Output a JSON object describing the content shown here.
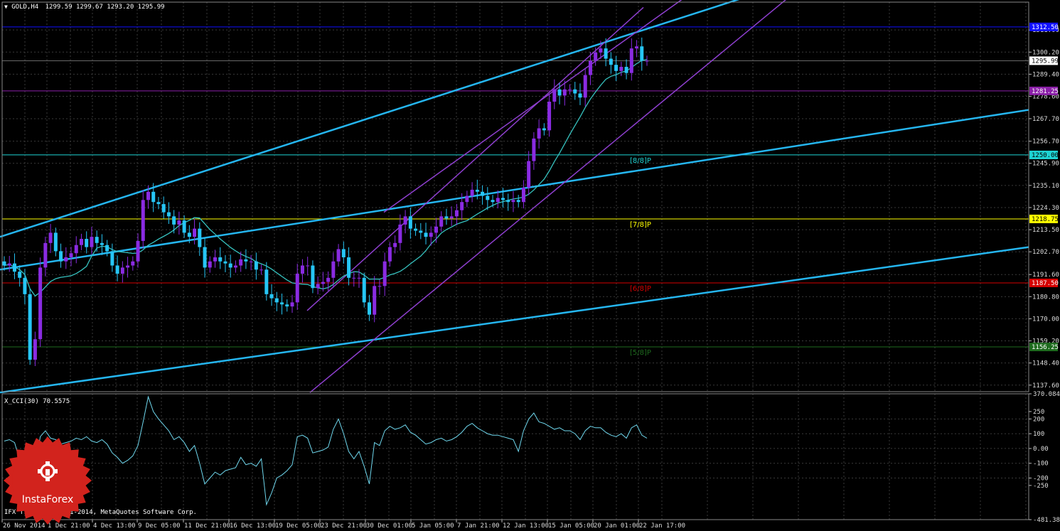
{
  "title": "GOLD,H4",
  "ohlc": {
    "values": "1299.59 1299.67 1293.20 1295.99"
  },
  "copyright": "IFX Trader, © 2001-2014, MetaQuotes Software Corp.",
  "logo_text": "InstaForex",
  "colors": {
    "background": "#000000",
    "grid": "#3a3a3a",
    "bull_candle": "#8a2be2",
    "bear_candle": "#26c6f6",
    "channel": "#8e3fcf",
    "trendline": "#25b6f0",
    "ma": "#36c2bf",
    "cci": "#6fd8ee",
    "level_8_8": "#1ed3d3",
    "level_7_8": "#ffff00",
    "level_6_8": "#d50000",
    "level_5_8": "#1e6b1e",
    "level_top": "#1111ff",
    "level_purple": "#8b1fa8"
  },
  "chart_data": [
    {
      "type": "candlestick",
      "title": "GOLD,H4",
      "price_ticks": [
        "1311.00",
        "1300.20",
        "1289.40",
        "1278.60",
        "1267.70",
        "1256.70",
        "1245.90",
        "1235.10",
        "1224.30",
        "1213.50",
        "1202.70",
        "1191.60",
        "1180.80",
        "1170.00",
        "1159.20",
        "1148.40",
        "1137.60"
      ],
      "x_tick_labels": [
        "26 Nov 2014",
        "1 Dec 21:00",
        "4 Dec 13:00",
        "9 Dec 05:00",
        "11 Dec 21:00",
        "16 Dec 13:00",
        "19 Dec 05:00",
        "23 Dec 21:00",
        "30 Dec 01:00",
        "5 Jan 05:00",
        "7 Jan 21:00",
        "12 Jan 13:00",
        "15 Jan 05:00",
        "20 Jan 01:00",
        "22 Jan 17:00"
      ],
      "ylim": [
        1134.4,
        1324.6
      ],
      "current_price": {
        "label": "1295.99",
        "value": 1295.99
      },
      "levels": [
        {
          "label": "[8/8]P",
          "value": 1250.0,
          "axis_label": "1250.00",
          "color": "#1ed3d3"
        },
        {
          "label": "[7/8]P",
          "value": 1218.75,
          "axis_label": "1218.75",
          "color": "#ffff00"
        },
        {
          "label": "[6/8]P",
          "value": 1187.5,
          "axis_label": "1187.50",
          "color": "#d50000"
        },
        {
          "label": "[5/8]P",
          "value": 1156.25,
          "axis_label": "1156.25",
          "color": "#1e6b1e"
        },
        {
          "label": "",
          "value": 1312.5,
          "axis_label": "1312.50",
          "color": "#1111ff"
        },
        {
          "label": "",
          "value": 1281.25,
          "axis_label": "1281.25",
          "color": "#8b1fa8"
        }
      ],
      "closes": [
        1196,
        1197,
        1193,
        1190,
        1182,
        1150,
        1160,
        1195,
        1207,
        1212,
        1203,
        1198,
        1200,
        1202,
        1206,
        1209,
        1205,
        1210,
        1207,
        1206,
        1203,
        1196,
        1192,
        1195,
        1196,
        1198,
        1208,
        1228,
        1232,
        1227,
        1226,
        1222,
        1220,
        1216,
        1218,
        1212,
        1210,
        1214,
        1205,
        1195,
        1198,
        1200,
        1198,
        1197,
        1195,
        1196,
        1199,
        1198,
        1198,
        1194,
        1194,
        1182,
        1180,
        1178,
        1177,
        1176,
        1178,
        1192,
        1196,
        1196,
        1185,
        1187,
        1188,
        1190,
        1198,
        1204,
        1200,
        1190,
        1190,
        1190,
        1178,
        1172,
        1186,
        1186,
        1198,
        1205,
        1207,
        1216,
        1220,
        1214,
        1213,
        1212,
        1210,
        1212,
        1215,
        1220,
        1219,
        1220,
        1223,
        1227,
        1230,
        1233,
        1232,
        1230,
        1228,
        1227,
        1229,
        1228,
        1227,
        1228,
        1227,
        1234,
        1247,
        1258,
        1263,
        1262,
        1276,
        1282,
        1279,
        1282,
        1282,
        1280,
        1278,
        1289,
        1296,
        1300,
        1302,
        1297,
        1294,
        1291,
        1293,
        1290,
        1302,
        1303,
        1296,
        1296
      ]
    },
    {
      "type": "line",
      "title": "X_CCI(30) 70.5575",
      "series": [
        {
          "name": "X_CCI(30)",
          "values": [
            50,
            60,
            40,
            -80,
            -100,
            -350,
            -150,
            80,
            120,
            70,
            60,
            30,
            40,
            50,
            70,
            60,
            80,
            50,
            40,
            60,
            30,
            -30,
            -60,
            -100,
            -80,
            -50,
            20,
            180,
            350,
            250,
            200,
            160,
            120,
            60,
            80,
            40,
            -20,
            20,
            -100,
            -240,
            -200,
            -160,
            -180,
            -150,
            -140,
            -130,
            -60,
            -110,
            -100,
            -120,
            -70,
            -380,
            -300,
            -200,
            -180,
            -150,
            -110,
            80,
            90,
            70,
            -30,
            -20,
            -10,
            10,
            130,
            200,
            100,
            -20,
            -70,
            -20,
            -120,
            -240,
            40,
            20,
            120,
            150,
            130,
            140,
            160,
            110,
            90,
            60,
            30,
            40,
            60,
            70,
            50,
            60,
            80,
            110,
            150,
            170,
            140,
            120,
            100,
            90,
            90,
            80,
            70,
            60,
            -20,
            120,
            200,
            240,
            180,
            170,
            150,
            130,
            140,
            120,
            120,
            100,
            60,
            120,
            150,
            140,
            140,
            110,
            90,
            80,
            100,
            70,
            140,
            160,
            90,
            70
          ]
        }
      ],
      "yticks": [
        "370.084",
        "250",
        "200",
        "100",
        "0.00",
        "-100",
        "-200",
        "-250",
        "-481.3897"
      ],
      "ylim": [
        -481.39,
        370.08
      ]
    }
  ]
}
